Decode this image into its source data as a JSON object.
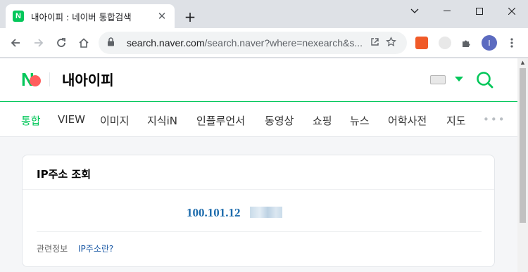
{
  "browser": {
    "tab_title": "내아이피 : 네이버 통합검색",
    "tab_favicon_letter": "N",
    "url_host": "search.naver.com",
    "url_path": "/search.naver?where=nexearch&s...",
    "profile_initial": "I"
  },
  "colors": {
    "naver_green": "#03c75a",
    "ip_blue": "#1c6bac",
    "link_blue": "#1c5aa6"
  },
  "search": {
    "query": "내아이피"
  },
  "nav": {
    "tabs": [
      "통합",
      "VIEW",
      "이미지",
      "지식iN",
      "인플루언서",
      "동영상",
      "쇼핑",
      "뉴스",
      "어학사전",
      "지도"
    ],
    "more": "•••"
  },
  "ip_card": {
    "title": "IP주소 조회",
    "ip_visible": "100.101.12",
    "related_label": "관련정보",
    "related_link": "IP주소란?"
  }
}
